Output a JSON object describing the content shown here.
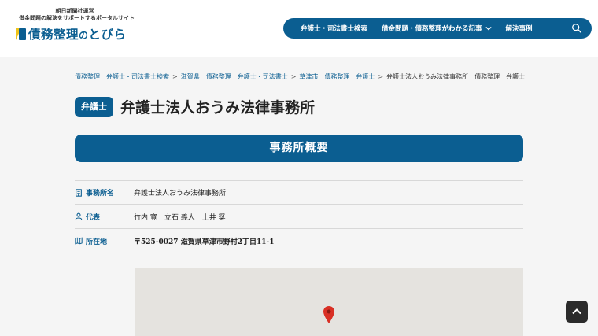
{
  "brand": {
    "sub1": "朝日新聞社運営",
    "sub2": "借金問題の解決をサポートするポータルサイト",
    "logo_main": "債務整理",
    "logo_mid": "の",
    "logo_end": "とびら"
  },
  "nav": {
    "items": [
      "弁護士・司法書士検索",
      "借金問題・債務整理がわかる記事",
      "解決事例"
    ],
    "search_icon": "search-icon",
    "dropdown_icon": "chevron-down-icon"
  },
  "breadcrumb": {
    "items": [
      "債務整理",
      "弁護士・司法書士検索",
      "滋賀県",
      "債務整理",
      "弁護士・司法書士",
      "草津市",
      "債務整理",
      "弁護士"
    ],
    "current": "弁護士法人おうみ法律事務所",
    "tail1": "債務整理",
    "tail2": "弁護士",
    "separator": ">"
  },
  "header": {
    "badge": "弁護士",
    "title": "弁護士法人おうみ法律事務所"
  },
  "section": {
    "title": "事務所概要"
  },
  "info": {
    "rows": [
      {
        "label": "事務所名",
        "value": "弁護士法人おうみ法律事務所",
        "icon": "building-icon"
      },
      {
        "label": "代表",
        "value": "竹内 寛　立石 義人　土井 奨",
        "icon": "person-icon"
      },
      {
        "label": "所在地",
        "value": "〒525-0027 滋賀県草津市野村2丁目11-1",
        "icon": "map-icon"
      }
    ]
  },
  "colors": {
    "brand": "#0b5e91",
    "accent": "#f0c419",
    "pin": "#d93025",
    "background": "#f5f5f5"
  }
}
